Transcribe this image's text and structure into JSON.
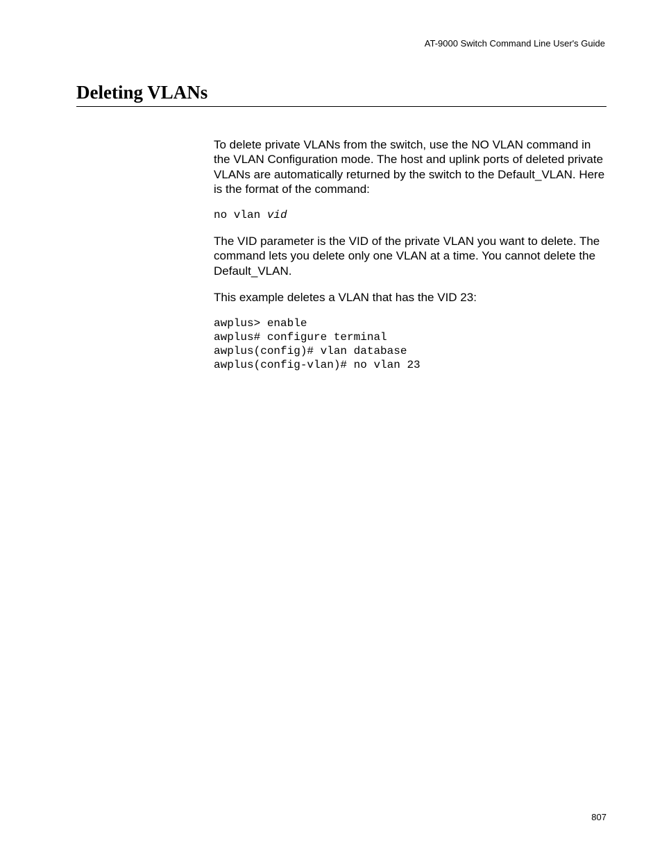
{
  "header": {
    "guide_title": "AT-9000 Switch Command Line User's Guide"
  },
  "section": {
    "title": "Deleting VLANs"
  },
  "content": {
    "para1": "To delete private VLANs from the switch, use the NO VLAN command in the VLAN Configuration mode. The host and uplink ports of deleted private VLANs are automatically returned by the switch to the Default_VLAN. Here is the format of the command:",
    "cmd_prefix": "no vlan ",
    "cmd_param": "vid",
    "para2": "The VID parameter is the VID of the private VLAN you want to delete. The command lets you delete only one VLAN at a time. You cannot delete the Default_VLAN.",
    "para3": "This example deletes a VLAN that has the VID 23:",
    "example": "awplus> enable\nawplus# configure terminal\nawplus(config)# vlan database\nawplus(config-vlan)# no vlan 23"
  },
  "footer": {
    "page_number": "807"
  }
}
